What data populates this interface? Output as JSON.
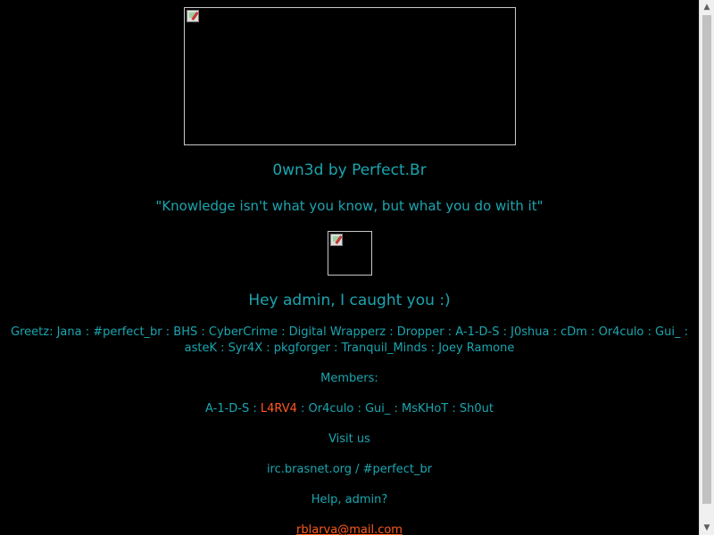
{
  "page": {
    "title": "0wn3d by Perfect.Br",
    "quote": "\"Knowledge isn't what you know, but what you do with it\"",
    "caught": "Hey admin, I caught you :)",
    "greetz_line1": "Greetz: Jana : #perfect_br : BHS : CyberCrime : Digital Wrapperz : Dropper : A-1-D-S : J0shua : cDm : Or4culo : Gui_ :",
    "greetz_line2": "asteK : Syr4X : pkgforger : Tranquil_Minds : Joey Ramone",
    "members_label": "Members:",
    "members_before": "A-1-D-S : ",
    "members_highlight": "L4RV4",
    "members_after": " : Or4culo : Gui_ : MsKHoT : Sh0ut",
    "visit": "Visit us",
    "irc": "irc.brasnet.org / #perfect_br",
    "help": "Help, admin?",
    "email": "rblarva@mail.com"
  },
  "colors": {
    "background": "#000000",
    "text": "#1aa6b0",
    "accent": "#ff5a1e"
  },
  "icons": {
    "broken_image": "broken-image-icon",
    "scroll_up": "arrow-up-icon",
    "scroll_down": "arrow-down-icon"
  }
}
